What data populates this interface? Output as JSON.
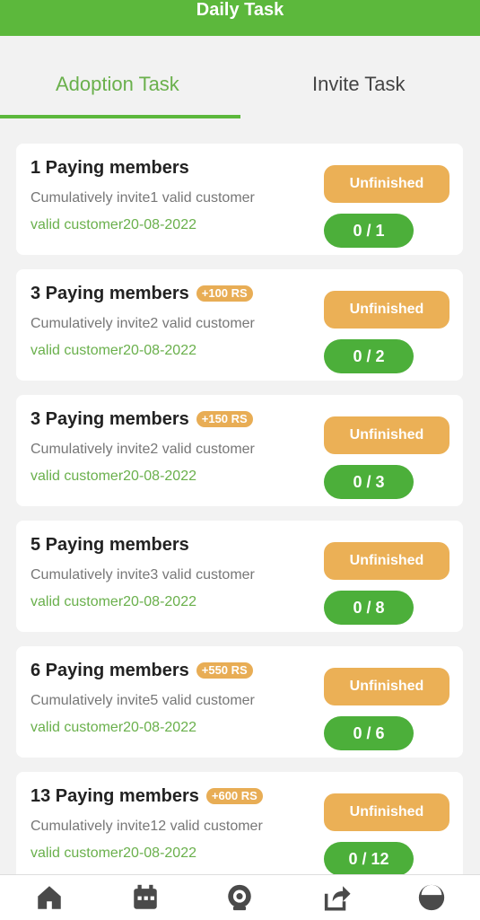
{
  "header": {
    "title": "Daily Task"
  },
  "tabs": [
    {
      "label": "Adoption Task"
    },
    {
      "label": "Invite Task"
    }
  ],
  "tasks": [
    {
      "name": "1 Paying members",
      "bonus": "",
      "desc": "Cumulatively invite1 valid customer",
      "date": "valid customer20-08-2022",
      "status": "Unfinished",
      "progress": "0 / 1"
    },
    {
      "name": "3 Paying members",
      "bonus": "+100 RS",
      "desc": "Cumulatively invite2 valid customer",
      "date": "valid customer20-08-2022",
      "status": "Unfinished",
      "progress": "0 / 2"
    },
    {
      "name": "3 Paying members",
      "bonus": "+150 RS",
      "desc": "Cumulatively invite2 valid customer",
      "date": "valid customer20-08-2022",
      "status": "Unfinished",
      "progress": "0 / 3"
    },
    {
      "name": "5 Paying members",
      "bonus": "",
      "desc": "Cumulatively invite3 valid customer",
      "date": "valid customer20-08-2022",
      "status": "Unfinished",
      "progress": "0 / 8"
    },
    {
      "name": "6 Paying members",
      "bonus": "+550 RS",
      "desc": "Cumulatively invite5 valid customer",
      "date": "valid customer20-08-2022",
      "status": "Unfinished",
      "progress": "0 / 6"
    },
    {
      "name": "13 Paying members",
      "bonus": "+600 RS",
      "desc": "Cumulatively invite12 valid customer",
      "date": "valid customer20-08-2022",
      "status": "Unfinished",
      "progress": "0 / 12"
    }
  ],
  "bottom_nav": [
    {
      "icon": "home-icon"
    },
    {
      "icon": "calendar-icon"
    },
    {
      "icon": "camera-icon"
    },
    {
      "icon": "share-icon"
    },
    {
      "icon": "profile-icon"
    }
  ],
  "colors": {
    "primary": "#5cb83c",
    "status": "#ebb056",
    "progress": "#4caf3a"
  }
}
